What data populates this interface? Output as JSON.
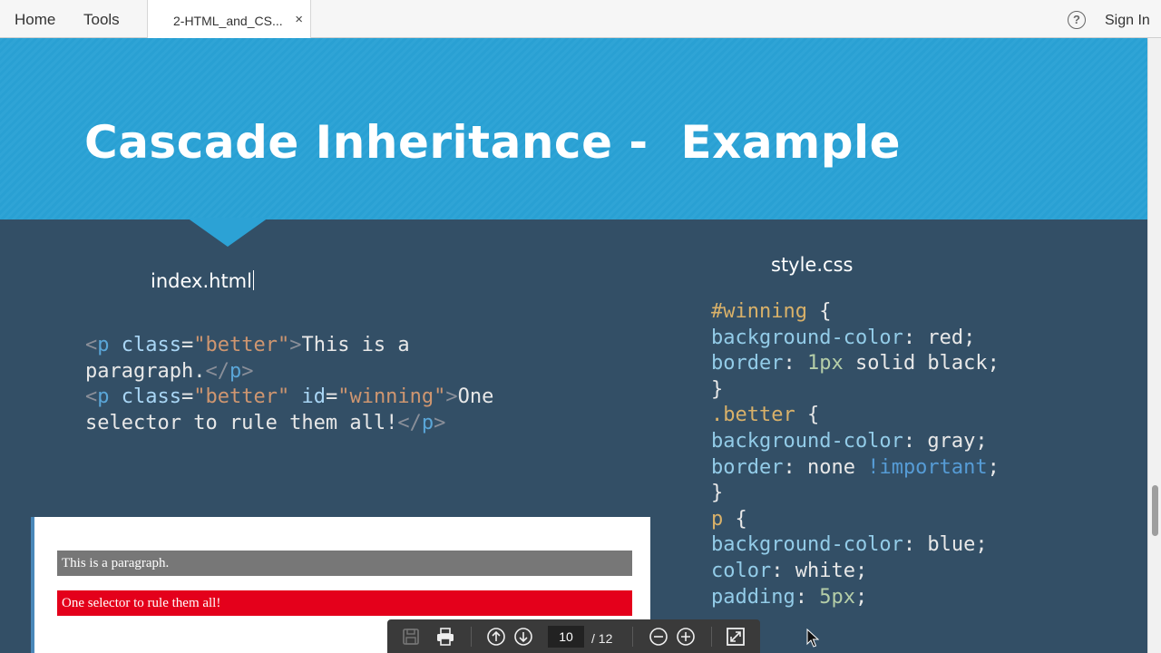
{
  "topbar": {
    "home": "Home",
    "tools": "Tools",
    "tab_title": "2-HTML_and_CS...",
    "tab_close": "×",
    "help": "?",
    "signin": "Sign In"
  },
  "slide": {
    "title": "Cascade Inheritance -  Example",
    "html_file": "index.html",
    "css_file": "style.css",
    "html_code": {
      "line1": {
        "lt": "<",
        "tag": "p",
        "attr": " class",
        "eq": "=",
        "val": "\"better\"",
        "gt": ">",
        "text": "This is a"
      },
      "line2": {
        "text": "paragraph.",
        "close": "</",
        "tag": "p",
        "gt": ">"
      },
      "line3": {
        "lt": "<",
        "tag": "p",
        "attr1": " class",
        "eq1": "=",
        "val1": "\"better\"",
        "attr2": " id",
        "eq2": "=",
        "val2": "\"winning\"",
        "gt": ">",
        "text": "One"
      },
      "line4": {
        "text": "selector to rule them all!",
        "close": "</",
        "tag": "p",
        "gt": ">"
      }
    },
    "css_code": {
      "sel1": "#winning",
      "brace_open": " {",
      "brace_close": "}",
      "r1_prop": "background-color",
      "r1_val": ": red;",
      "r2_prop": "border",
      "r2_num": " 1px",
      "r2_rest": " solid black;",
      "sel2": ".better",
      "r3_prop": "background-color",
      "r3_val": ": gray;",
      "r4_prop": "border",
      "r4_val": ": none ",
      "r4_imp": "!important",
      "r4_semi": ";",
      "sel3": "p",
      "r5_prop": "background-color",
      "r5_val": ": blue;",
      "r6_prop": "color",
      "r6_val": ": white;",
      "r7_prop": "padding",
      "r7_num": " 5px",
      "r7_semi": ";"
    },
    "preview": {
      "p1": "This is a paragraph.",
      "p2": "One selector to rule them all!"
    }
  },
  "toolbar": {
    "current_page": "10",
    "total_pages": "/ 12"
  }
}
